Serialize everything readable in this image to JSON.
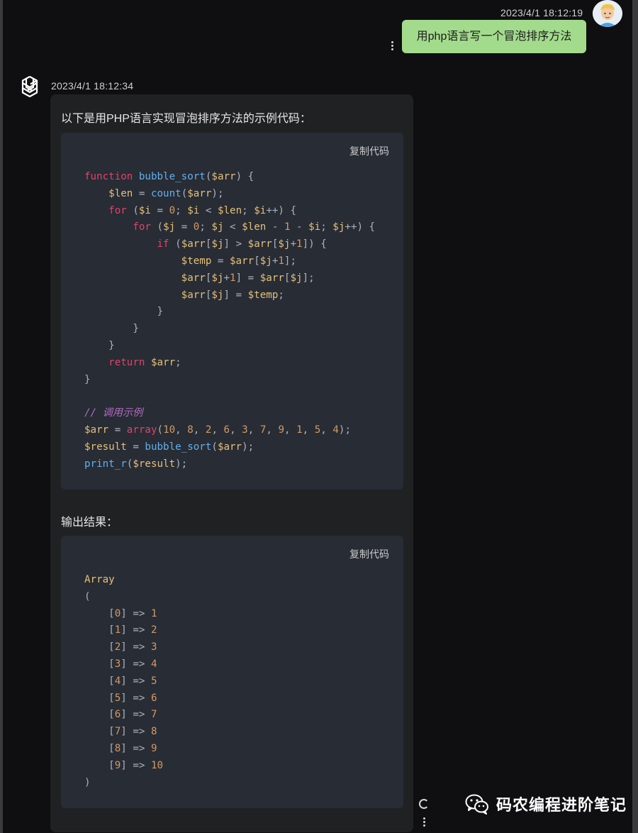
{
  "user_message": {
    "timestamp": "2023/4/1 18:12:19",
    "text": "用php语言写一个冒泡排序方法"
  },
  "bot_message": {
    "timestamp": "2023/4/1 18:12:34",
    "intro": "以下是用PHP语言实现冒泡排序方法的示例代码：",
    "output_label": "输出结果：",
    "copy_label": "复制代码"
  },
  "code_blocks": [
    {
      "copy_label": "复制代码",
      "lines": [
        "function bubble_sort($arr) {",
        "    $len = count($arr);",
        "    for ($i = 0; $i < $len; $i++) {",
        "        for ($j = 0; $j < $len - 1 - $i; $j++) {",
        "            if ($arr[$j] > $arr[$j+1]) {",
        "                $temp = $arr[$j+1];",
        "                $arr[$j+1] = $arr[$j];",
        "                $arr[$j] = $temp;",
        "            }",
        "        }",
        "    }",
        "    return $arr;",
        "}",
        "",
        "// 调用示例",
        "$arr = array(10, 8, 2, 6, 3, 7, 9, 1, 5, 4);",
        "$result = bubble_sort($arr);",
        "print_r($result);"
      ]
    },
    {
      "copy_label": "复制代码",
      "lines": [
        "Array",
        "(",
        "    [0] => 1",
        "    [1] => 2",
        "    [2] => 3",
        "    [3] => 4",
        "    [4] => 5",
        "    [5] => 6",
        "    [6] => 7",
        "    [7] => 8",
        "    [8] => 9",
        "    [9] => 10",
        ")"
      ]
    }
  ],
  "watermark": {
    "text": "码农编程进阶笔记",
    "icon": "wechat-icon"
  },
  "colors": {
    "background": "#0f0f11",
    "user_bubble": "#a3db8d",
    "bot_card": "#202123",
    "code_bg": "#282c34",
    "keyword": "#e0426d",
    "function": "#61afef",
    "variable": "#e5c07b",
    "number": "#d19a66"
  }
}
